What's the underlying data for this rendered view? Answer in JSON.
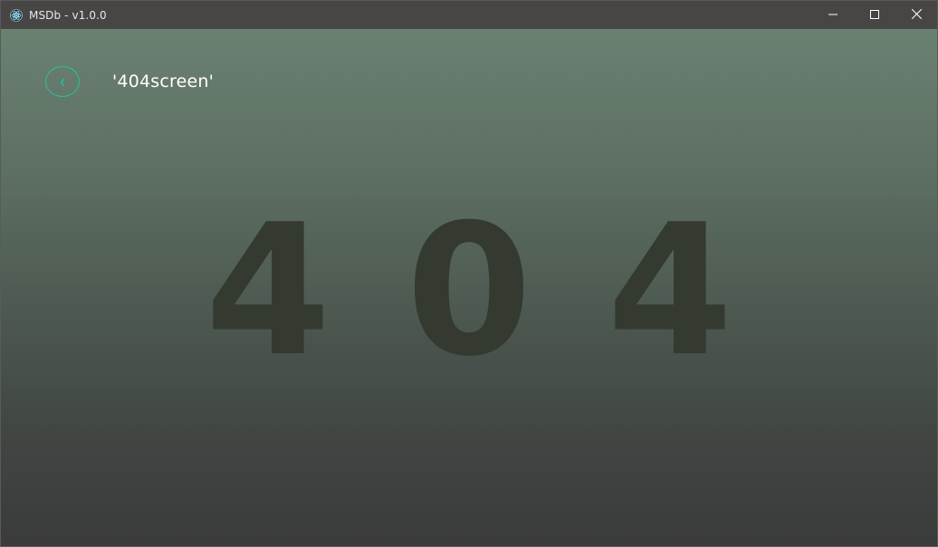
{
  "window": {
    "title": "MSDb - v1.0.0",
    "icon": "electron-atom-icon",
    "controls": {
      "minimize": "minimize-icon",
      "maximize": "maximize-icon",
      "close": "close-icon"
    }
  },
  "header": {
    "back_icon": "chevron-left-icon",
    "title": "'404screen'"
  },
  "main": {
    "digits": [
      "4",
      "0",
      "4"
    ]
  },
  "colors": {
    "accent": "#1fc5a0",
    "titlebar": "#474645",
    "digit": "#343a30",
    "gradient_top": "#6a8172",
    "gradient_bottom": "#3a3b3a"
  }
}
